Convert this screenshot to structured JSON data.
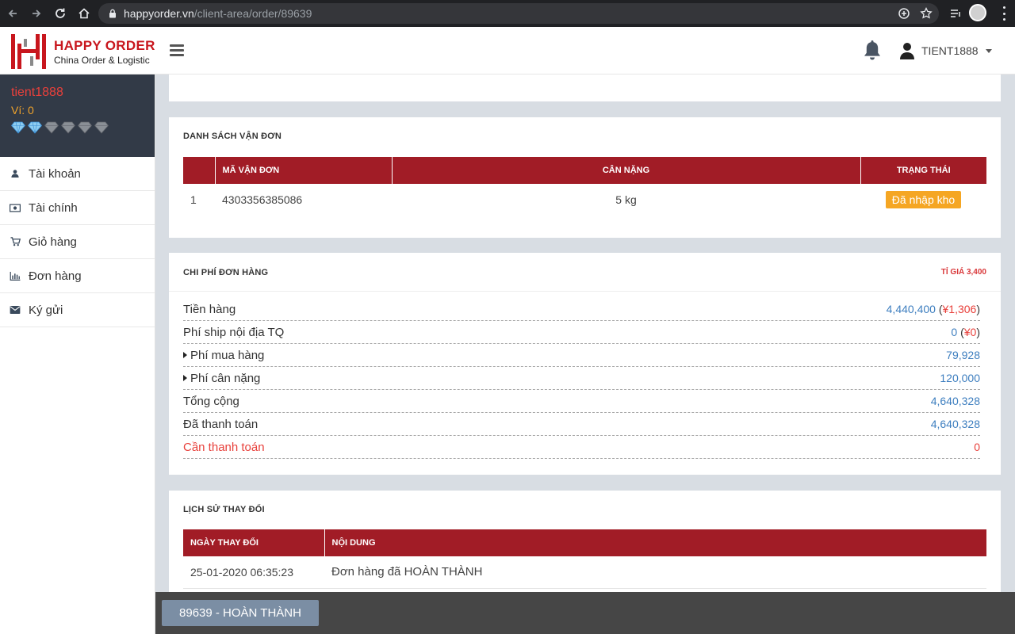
{
  "browser": {
    "url_host": "happyorder.vn",
    "url_path": "/client-area/order/89639"
  },
  "header": {
    "logo_title": "HAPPY ORDER",
    "logo_subtitle": "China Order & Logistic",
    "username": "TIENT1888"
  },
  "sidebar": {
    "profile_name": "tient1888",
    "wallet": "Ví: 0",
    "gems_active": 2,
    "gems_total": 6,
    "items": [
      {
        "label": "Tài khoản",
        "icon": "user-icon"
      },
      {
        "label": "Tài chính",
        "icon": "money-icon"
      },
      {
        "label": "Giỏ hàng",
        "icon": "cart-icon"
      },
      {
        "label": "Đơn hàng",
        "icon": "bar-chart-icon"
      },
      {
        "label": "Ký gửi",
        "icon": "envelope-icon"
      }
    ]
  },
  "waybills": {
    "title": "DANH SÁCH VẬN ĐƠN",
    "columns": [
      "",
      "MÃ VẬN ĐƠN",
      "CÂN NẶNG",
      "TRẠNG THÁI"
    ],
    "rows": [
      {
        "no": "1",
        "code": "4303356385086",
        "weight": "5 kg",
        "status": "Đã nhập kho"
      }
    ]
  },
  "costs": {
    "title": "CHI PHÍ ĐƠN HÀNG",
    "rate": "TỈ GIÁ 3,400",
    "rows": [
      {
        "label": "Tiền hàng",
        "value": "4,440,400",
        "yuan": "¥1,306",
        "expandable": false
      },
      {
        "label": "Phí ship nội địa TQ",
        "value": "0",
        "yuan": "¥0",
        "expandable": false
      },
      {
        "label": "Phí mua hàng",
        "value": "79,928",
        "yuan": "",
        "expandable": true
      },
      {
        "label": "Phí cân nặng",
        "value": "120,000",
        "yuan": "",
        "expandable": true
      },
      {
        "label": "Tổng cộng",
        "value": "4,640,328",
        "yuan": "",
        "expandable": false
      },
      {
        "label": "Đã thanh toán",
        "value": "4,640,328",
        "yuan": "",
        "expandable": false
      },
      {
        "label": "Cần thanh toán",
        "value": "0",
        "yuan": "",
        "expandable": false
      }
    ]
  },
  "history": {
    "title": "LỊCH SỬ THAY ĐỔI",
    "columns": [
      "NGÀY THAY ĐỔI",
      "NỘI DUNG"
    ],
    "rows": [
      {
        "date": "25-01-2020 06:35:23",
        "content": "Đơn hàng đã HOÀN THÀNH"
      }
    ]
  },
  "bottom_bar": {
    "order_status": "89639 - HOÀN THÀNH"
  },
  "colors": {
    "brand_red": "#a11c26",
    "logo_red": "#c8161d",
    "sidebar_dark": "#323a47",
    "status_orange": "#f5a623",
    "value_blue": "#3d7ebf",
    "due_red": "#e8403b"
  }
}
